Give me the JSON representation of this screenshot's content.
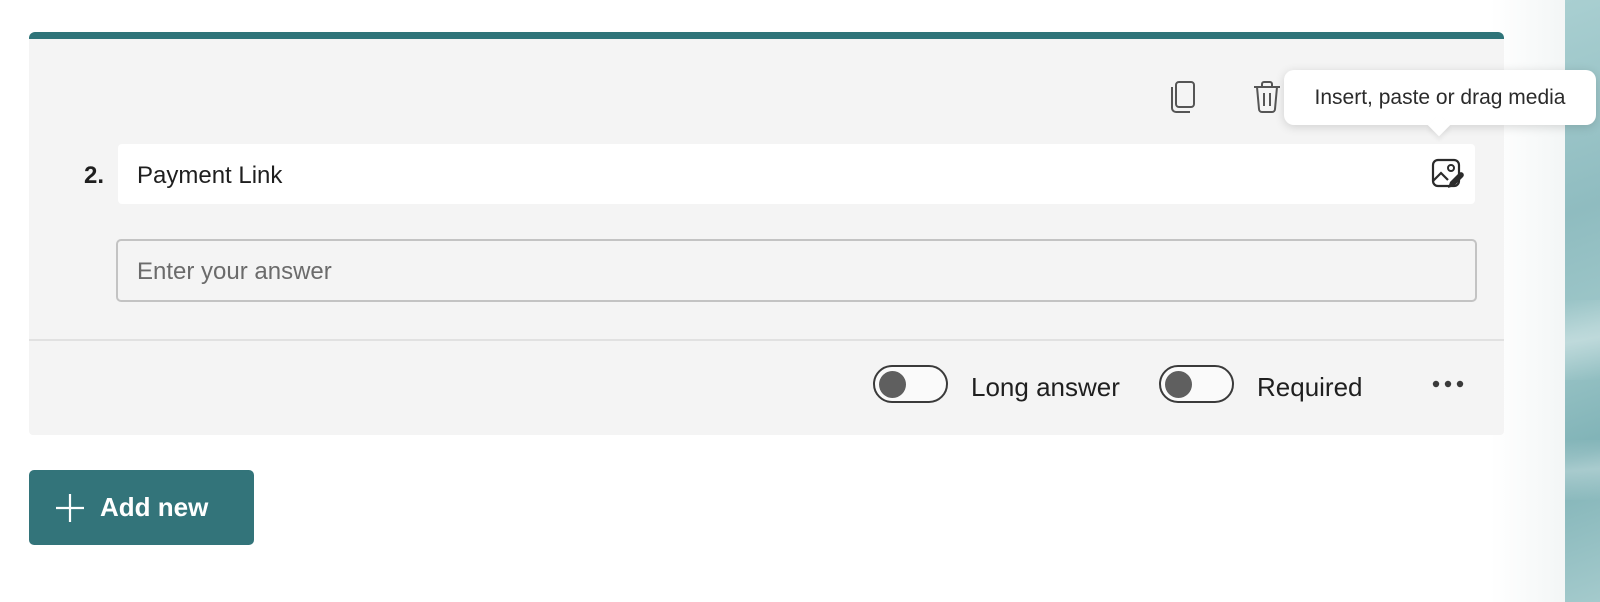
{
  "question": {
    "number": "2.",
    "title": "Payment Link",
    "answer_placeholder": "Enter your answer",
    "accent_color": "#2f7479"
  },
  "toolbar": {
    "copy_icon": "copy-icon",
    "delete_icon": "trash-icon",
    "media_icon": "image-edit-icon",
    "media_tooltip": "Insert, paste or drag media"
  },
  "options": {
    "long_answer_label": "Long answer",
    "long_answer_on": false,
    "required_label": "Required",
    "required_on": false,
    "more_icon": "more-horizontal-icon"
  },
  "actions": {
    "add_new_label": "Add new",
    "add_new_color": "#33747a"
  }
}
